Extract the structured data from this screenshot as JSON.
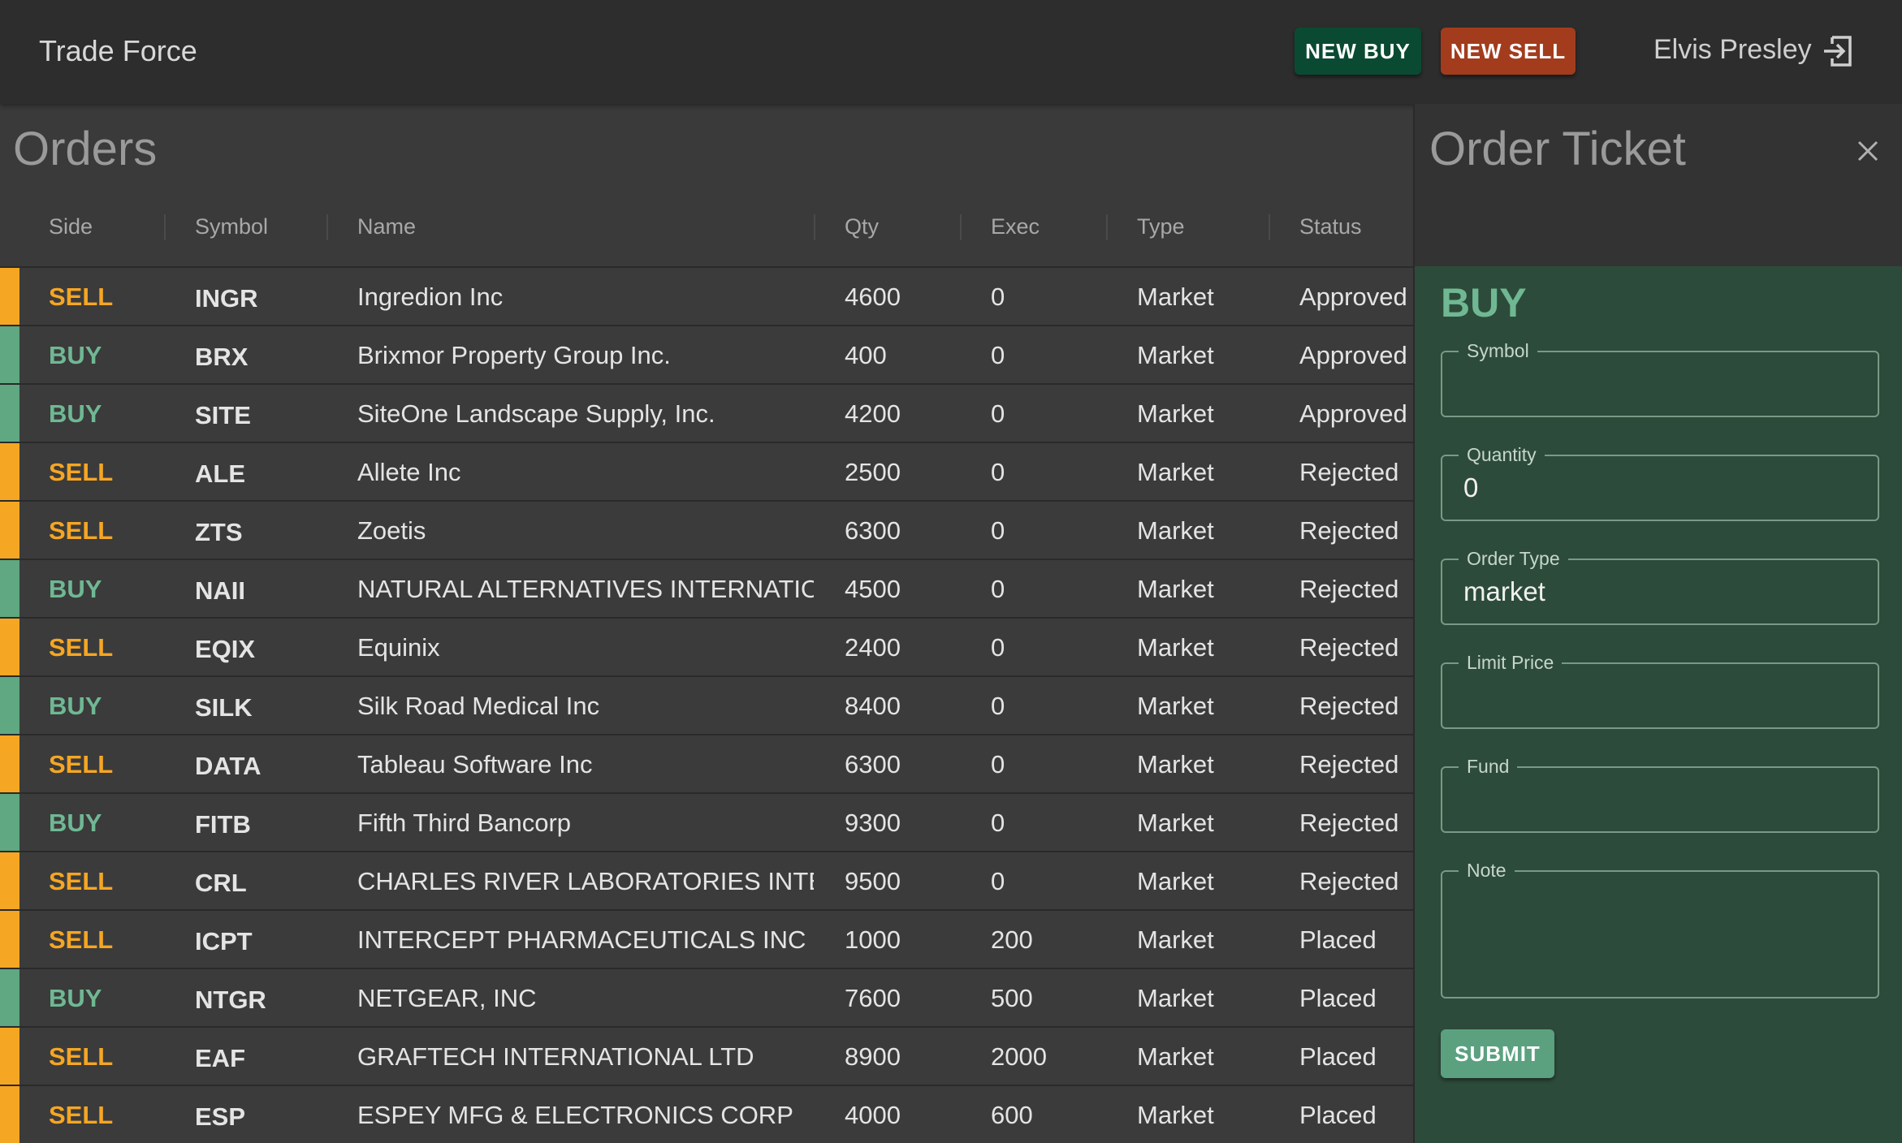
{
  "header": {
    "app_title": "Trade Force",
    "new_buy_label": "NEW BUY",
    "new_sell_label": "NEW SELL",
    "user_name": "Elvis Presley"
  },
  "orders": {
    "title": "Orders",
    "columns": [
      "Side",
      "Symbol",
      "Name",
      "Qty",
      "Exec",
      "Type",
      "Status"
    ],
    "rows": [
      {
        "side": "SELL",
        "symbol": "INGR",
        "name": "Ingredion Inc",
        "qty": "4600",
        "exec": "0",
        "type": "Market",
        "status": "Approved"
      },
      {
        "side": "BUY",
        "symbol": "BRX",
        "name": "Brixmor Property Group Inc.",
        "qty": "400",
        "exec": "0",
        "type": "Market",
        "status": "Approved"
      },
      {
        "side": "BUY",
        "symbol": "SITE",
        "name": "SiteOne Landscape Supply, Inc.",
        "qty": "4200",
        "exec": "0",
        "type": "Market",
        "status": "Approved"
      },
      {
        "side": "SELL",
        "symbol": "ALE",
        "name": "Allete Inc",
        "qty": "2500",
        "exec": "0",
        "type": "Market",
        "status": "Rejected"
      },
      {
        "side": "SELL",
        "symbol": "ZTS",
        "name": "Zoetis",
        "qty": "6300",
        "exec": "0",
        "type": "Market",
        "status": "Rejected"
      },
      {
        "side": "BUY",
        "symbol": "NAII",
        "name": "NATURAL ALTERNATIVES INTERNATIONAL",
        "qty": "4500",
        "exec": "0",
        "type": "Market",
        "status": "Rejected"
      },
      {
        "side": "SELL",
        "symbol": "EQIX",
        "name": "Equinix",
        "qty": "2400",
        "exec": "0",
        "type": "Market",
        "status": "Rejected"
      },
      {
        "side": "BUY",
        "symbol": "SILK",
        "name": "Silk Road Medical Inc",
        "qty": "8400",
        "exec": "0",
        "type": "Market",
        "status": "Rejected"
      },
      {
        "side": "SELL",
        "symbol": "DATA",
        "name": "Tableau Software Inc",
        "qty": "6300",
        "exec": "0",
        "type": "Market",
        "status": "Rejected"
      },
      {
        "side": "BUY",
        "symbol": "FITB",
        "name": "Fifth Third Bancorp",
        "qty": "9300",
        "exec": "0",
        "type": "Market",
        "status": "Rejected"
      },
      {
        "side": "SELL",
        "symbol": "CRL",
        "name": "CHARLES RIVER LABORATORIES INTERNATIONAL",
        "qty": "9500",
        "exec": "0",
        "type": "Market",
        "status": "Rejected"
      },
      {
        "side": "SELL",
        "symbol": "ICPT",
        "name": "INTERCEPT PHARMACEUTICALS INC",
        "qty": "1000",
        "exec": "200",
        "type": "Market",
        "status": "Placed"
      },
      {
        "side": "BUY",
        "symbol": "NTGR",
        "name": "NETGEAR, INC",
        "qty": "7600",
        "exec": "500",
        "type": "Market",
        "status": "Placed"
      },
      {
        "side": "SELL",
        "symbol": "EAF",
        "name": "GRAFTECH INTERNATIONAL LTD",
        "qty": "8900",
        "exec": "2000",
        "type": "Market",
        "status": "Placed"
      },
      {
        "side": "SELL",
        "symbol": "ESP",
        "name": "ESPEY MFG & ELECTRONICS CORP",
        "qty": "4000",
        "exec": "600",
        "type": "Market",
        "status": "Placed"
      }
    ]
  },
  "ticket": {
    "title": "Order Ticket",
    "side": "BUY",
    "fields": [
      {
        "label": "Symbol",
        "value": ""
      },
      {
        "label": "Quantity",
        "value": "0"
      },
      {
        "label": "Order Type",
        "value": "market"
      },
      {
        "label": "Limit Price",
        "value": ""
      },
      {
        "label": "Fund",
        "value": ""
      },
      {
        "label": "Note",
        "value": ""
      }
    ],
    "submit_label": "SUBMIT"
  },
  "colors": {
    "sell_stripe": "#f5a623",
    "buy_stripe": "#5fa882",
    "sell_text": "#f5a623",
    "buy_text": "#6fb893",
    "new_buy_bg": "#0a4a32",
    "new_sell_bg": "#a23c1d",
    "ticket_bg": "#2d4b3a",
    "submit_bg": "#5ba180"
  },
  "icons": {
    "logout": "logout-icon",
    "close": "close-icon"
  }
}
